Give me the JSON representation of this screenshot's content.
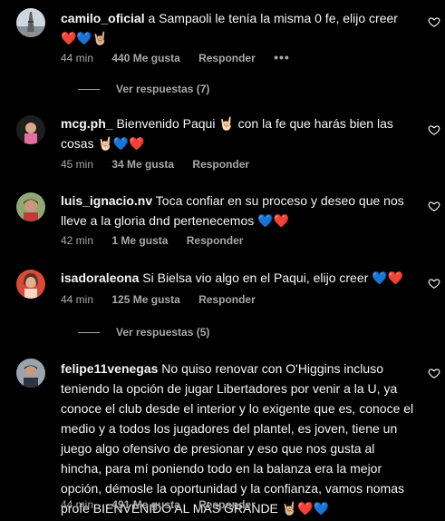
{
  "comments": [
    {
      "username": "camilo_oficial",
      "text": " a Sampaoli le tenía la misma 0 fe, elijo creer ❤️💙🤘🏼",
      "time": "44 min",
      "likes": "440 Me gusta",
      "reply": "Responder",
      "more": "•••"
    },
    {
      "username": "mcg.ph_",
      "text": "  Bienvenido Paqui 🤘🏻  con la fe que harás bien las cosas 🤘🏻💙❤️",
      "time": "45 min",
      "likes": "34 Me gusta",
      "reply": "Responder"
    },
    {
      "username": "luis_ignacio.nv",
      "text": " Toca confiar en su proceso y deseo que nos lleve a la gloria dnd pertenecemos 💙❤️",
      "time": "42 min",
      "likes": "1 Me gusta",
      "reply": "Responder"
    },
    {
      "username": "isadoraleona",
      "text": " Si Bielsa vio algo en el Paqui, elijo creer 💙❤️",
      "time": "44 min",
      "likes": "125 Me gusta",
      "reply": "Responder"
    },
    {
      "username": "felipe11venegas",
      "text": " No quiso renovar con O'Higgins incluso teniendo la opción de jugar Libertadores por venir a la U, ya conoce el club desde el interior y lo exigente que es, conoce el medio y a todos los jugadores del plantel, es joven, tiene un juego algo ofensivo de presionar y eso que nos gusta al hincha, para mí poniendo todo en la balanza era la mejor opción, démosle la oportunidad y la confianza, vamos nomas profe BIENVENIDO AL MÁS GRANDE 🤘🏼❤️💙",
      "time": "44 min",
      "likes": "491 Me gusta",
      "reply": "Responder"
    }
  ],
  "replies_links": {
    "first": "Ver respuestas (7)",
    "second": "Ver respuestas (5)"
  },
  "colors": {
    "background": "#000000",
    "text": "#f5f5f5",
    "muted": "#a8a8a8"
  },
  "icons": {
    "like": "heart-outline-icon"
  }
}
